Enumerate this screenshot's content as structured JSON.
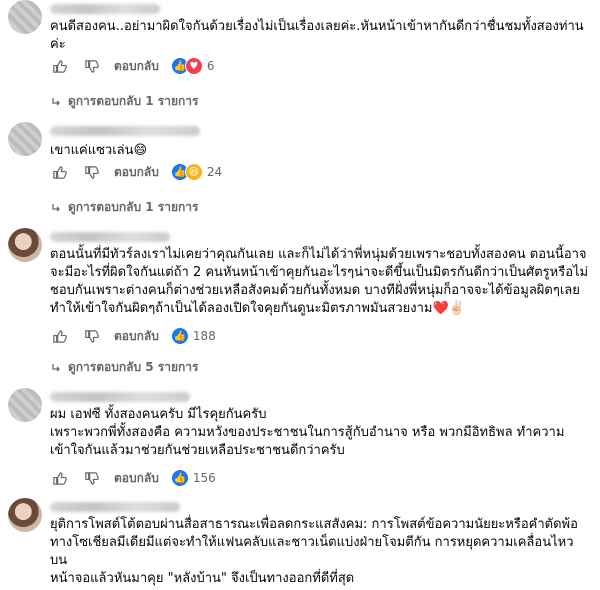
{
  "comments": [
    {
      "lines": [
        "คนดีสองคน..อย่ามาผิดใจกันด้วยเรื่องไม่เป็นเรื่องเลยค่ะ.หันหน้าเข้าหากันดีกว่าชื่นชมทั้งสองท่าน",
        "ค่ะ"
      ],
      "reply_label": "ตอบกลับ",
      "reaction_count": "6",
      "replies_label": "ดูการตอบกลับ 1 รายการ"
    },
    {
      "lines": [
        "เขาแค่แซวเล่น😄"
      ],
      "reply_label": "ตอบกลับ",
      "reaction_count": "24",
      "replies_label": "ดูการตอบกลับ 1 รายการ"
    },
    {
      "lines": [
        "ตอนนั้นที่มีทัวร์ลงเราไม่เคยว่าคุณกันเลย และก็ไม่ได้ว่าพี่หนุ่มด้วยเพราะชอบทั้งสองคน ตอนนี้อาจ",
        "จะมีอะไรที่ผิดใจกันแต่ถ้า 2 คนหันหน้าเข้าคุยกันอะไรๆน่าจะดีขึ้นเป็นมิตรกันดีกว่าเป็นศัตรูหรือไม่",
        "ชอบกันเพราะต่างคนก็ต่างช่วยเหลือสังคมด้วยกันทั้งหมด บางทีฝั่งพี่หนุ่มก็อาจจะได้ข้อมูลผิดๆเลย",
        "ทำให้เข้าใจกันผิดๆถ้าเป็นได้ลองเปิดใจคุยกันดูนะมิตรภาพมันสวยงาม❤️✌🏻"
      ],
      "reply_label": "ตอบกลับ",
      "reaction_count": "188",
      "replies_label": "ดูการตอบกลับ 5 รายการ"
    },
    {
      "lines": [
        "ผม เอฟซี ทั้งสองคนครับ มีไรคุยกันครับ",
        "เพราะพวกพี่ทั้งสองคือ ความหวังของประชาชนในการสู้กับอำนาจ หรือ พวกมีอิทธิพล ทำความ",
        "เข้าใจกันแล้วมาช่วยกันช่วยเหลือประชาชนดีกว่าครับ"
      ],
      "reply_label": "ตอบกลับ",
      "reaction_count": "156"
    },
    {
      "lines": [
        "ยุติการโพสต์โต้ตอบผ่านสื่อสาธารณะเพื่อลดกระแสสังคม: การโพสต์ข้อความนัยยะหรือคำตัดพ้อ",
        "ทางโซเชียลมีเดียมีแต่จะทำให้แฟนคลับและชาวเน็ตแบ่งฝ่ายโจมตีกัน การหยุดความเคลื่อนไหวบน",
        "หน้าจอแล้วหันมาคุย \"หลังบ้าน\" จึงเป็นทางออกที่ดีที่สุด"
      ]
    }
  ],
  "colors": {
    "like": "#1877f2",
    "love": "#f33e58",
    "haha": "#f7b125",
    "meta_text": "#65676b"
  }
}
